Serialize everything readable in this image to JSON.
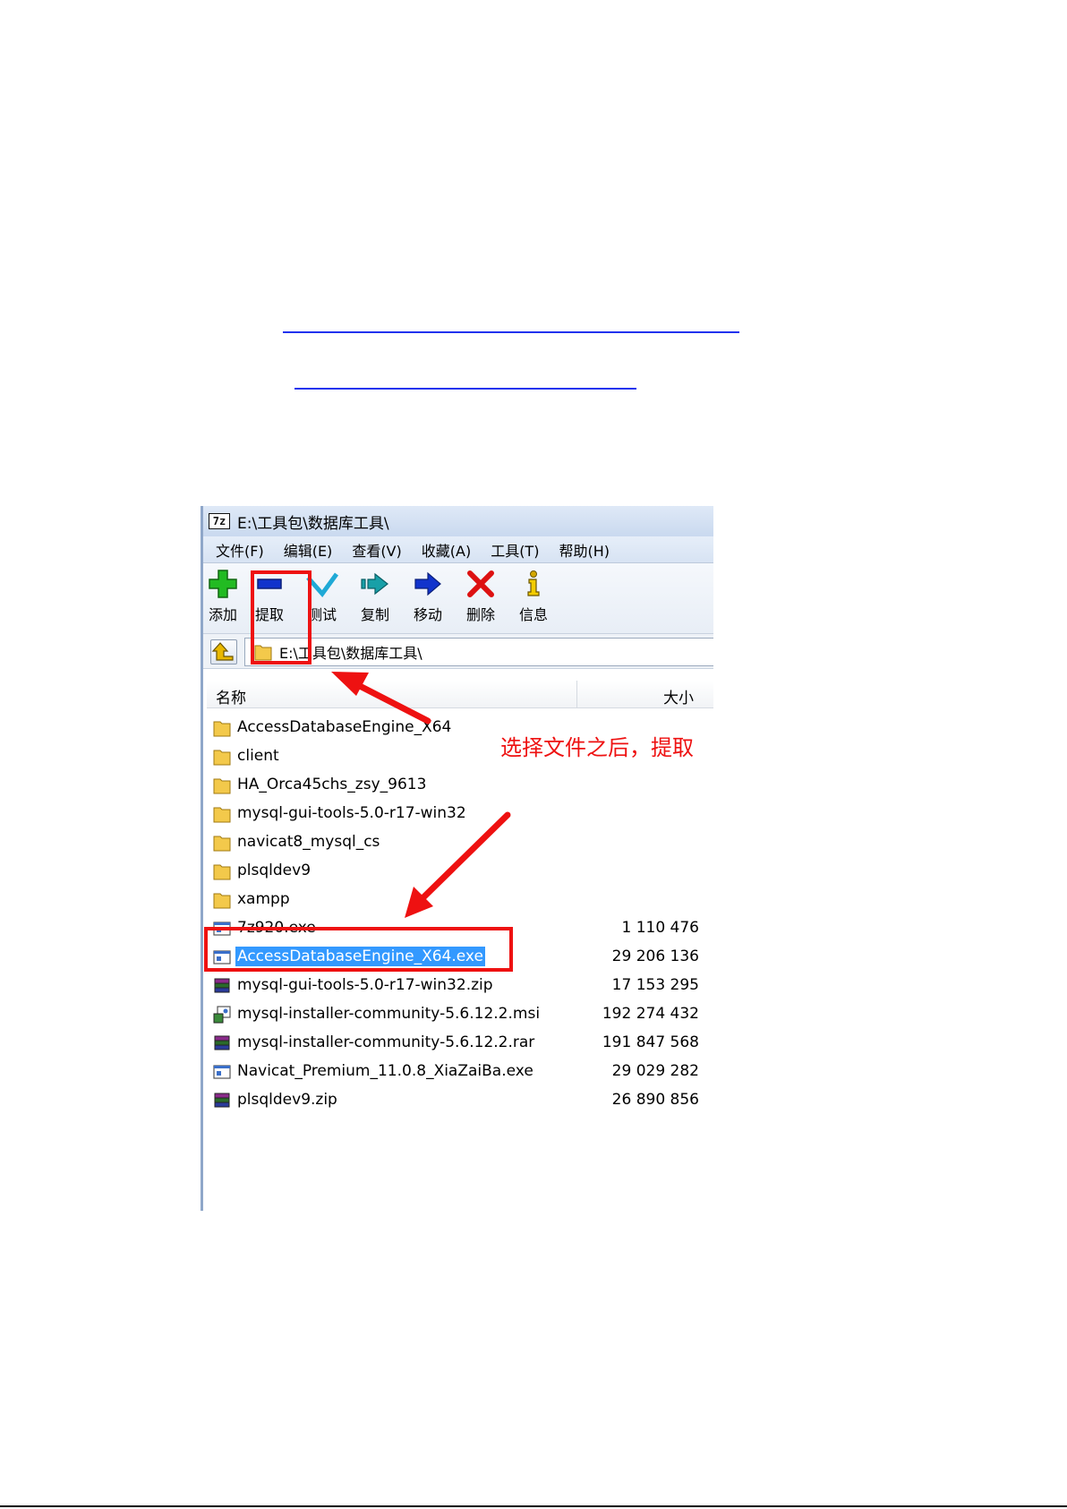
{
  "window": {
    "title": "E:\\工具包\\数据库工具\\",
    "app_icon_label": "7z",
    "menu": [
      "文件(F)",
      "编辑(E)",
      "查看(V)",
      "收藏(A)",
      "工具(T)",
      "帮助(H)"
    ],
    "toolbar": [
      {
        "label": "添加",
        "icon": "add-icon"
      },
      {
        "label": "提取",
        "icon": "extract-icon"
      },
      {
        "label": "测试",
        "icon": "test-icon"
      },
      {
        "label": "复制",
        "icon": "copy-icon"
      },
      {
        "label": "移动",
        "icon": "move-icon"
      },
      {
        "label": "删除",
        "icon": "delete-icon"
      },
      {
        "label": "信息",
        "icon": "info-icon"
      }
    ],
    "address": "E:\\工具包\\数据库工具\\",
    "columns": {
      "name": "名称",
      "size": "大小"
    },
    "files": [
      {
        "name": "AccessDatabaseEngine_X64",
        "size": "",
        "type": "folder"
      },
      {
        "name": "client",
        "size": "",
        "type": "folder"
      },
      {
        "name": "HA_Orca45chs_zsy_9613",
        "size": "",
        "type": "folder"
      },
      {
        "name": "mysql-gui-tools-5.0-r17-win32",
        "size": "",
        "type": "folder"
      },
      {
        "name": "navicat8_mysql_cs",
        "size": "",
        "type": "folder"
      },
      {
        "name": "plsqldev9",
        "size": "",
        "type": "folder"
      },
      {
        "name": "xampp",
        "size": "",
        "type": "folder"
      },
      {
        "name": "7z920.exe",
        "size": "1 110 476",
        "type": "exe"
      },
      {
        "name": "AccessDatabaseEngine_X64.exe",
        "size": "29 206 136",
        "type": "exe",
        "selected": true
      },
      {
        "name": "mysql-gui-tools-5.0-r17-win32.zip",
        "size": "17 153 295",
        "type": "archive"
      },
      {
        "name": "mysql-installer-community-5.6.12.2.msi",
        "size": "192 274 432",
        "type": "msi"
      },
      {
        "name": "mysql-installer-community-5.6.12.2.rar",
        "size": "191 847 568",
        "type": "archive"
      },
      {
        "name": "Navicat_Premium_11.0.8_XiaZaiBa.exe",
        "size": "29 029 282",
        "type": "exe"
      },
      {
        "name": "plsqldev9.zip",
        "size": "26 890 856",
        "type": "archive"
      }
    ]
  },
  "annotation": {
    "text": "选择文件之后，提取",
    "color": "#ee1111"
  },
  "colors": {
    "selection": "#3399ff",
    "link": "#2233ee"
  }
}
